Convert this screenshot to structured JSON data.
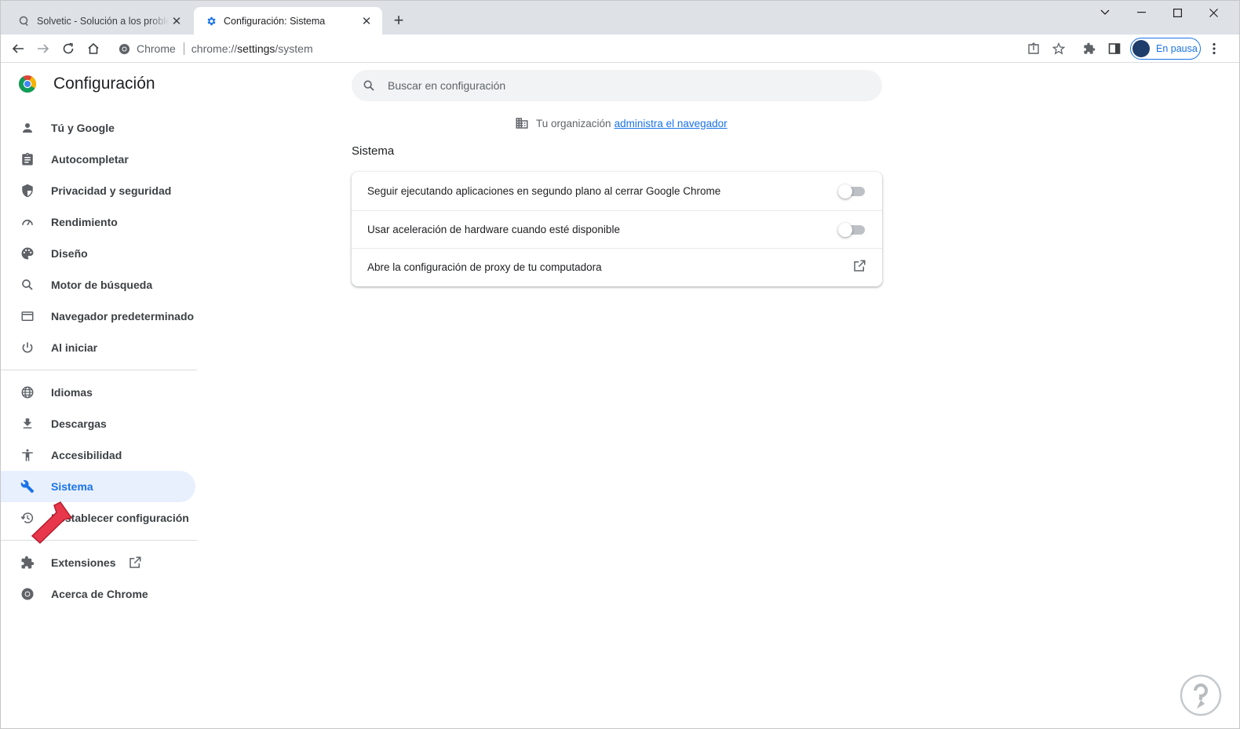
{
  "browser": {
    "tabs": [
      {
        "title": "Solvetic - Solución a los problemas",
        "icon": "solvetic-favicon-icon",
        "active": false
      },
      {
        "title": "Configuración: Sistema",
        "icon": "gear-icon",
        "active": true
      }
    ],
    "omnibox": {
      "site_label": "Chrome",
      "url_prefix": "chrome://",
      "url_host": "settings",
      "url_path": "/system"
    },
    "profile_label": "En pausa",
    "accent": "#1a73e8"
  },
  "settings": {
    "title": "Configuración",
    "search_placeholder": "Buscar en configuración",
    "managed_text": "Tu organización",
    "managed_link": "administra el navegador",
    "nav_main": [
      {
        "label": "Tú y Google",
        "icon": "person-icon"
      },
      {
        "label": "Autocompletar",
        "icon": "clipboard-icon"
      },
      {
        "label": "Privacidad y seguridad",
        "icon": "shield-icon"
      },
      {
        "label": "Rendimiento",
        "icon": "speedometer-icon"
      },
      {
        "label": "Diseño",
        "icon": "palette-icon"
      },
      {
        "label": "Motor de búsqueda",
        "icon": "search-icon"
      },
      {
        "label": "Navegador predeterminado",
        "icon": "browser-window-icon"
      },
      {
        "label": "Al iniciar",
        "icon": "power-icon"
      }
    ],
    "nav_advanced": [
      {
        "label": "Idiomas",
        "icon": "globe-icon"
      },
      {
        "label": "Descargas",
        "icon": "download-icon"
      },
      {
        "label": "Accesibilidad",
        "icon": "accessibility-icon"
      },
      {
        "label": "Sistema",
        "icon": "wrench-icon",
        "active": true
      },
      {
        "label": "Restablecer configuración",
        "icon": "restore-icon"
      }
    ],
    "nav_footer": [
      {
        "label": "Extensiones",
        "icon": "puzzle-icon"
      },
      {
        "label": "Acerca de Chrome",
        "icon": "chrome-icon"
      }
    ],
    "section_title": "Sistema",
    "rows": [
      {
        "label": "Seguir ejecutando aplicaciones en segundo plano al cerrar Google Chrome",
        "control": "toggle",
        "on": false
      },
      {
        "label": "Usar aceleración de hardware cuando esté disponible",
        "control": "toggle",
        "on": false
      },
      {
        "label": "Abre la configuración de proxy de tu computadora",
        "control": "external-link"
      }
    ]
  }
}
